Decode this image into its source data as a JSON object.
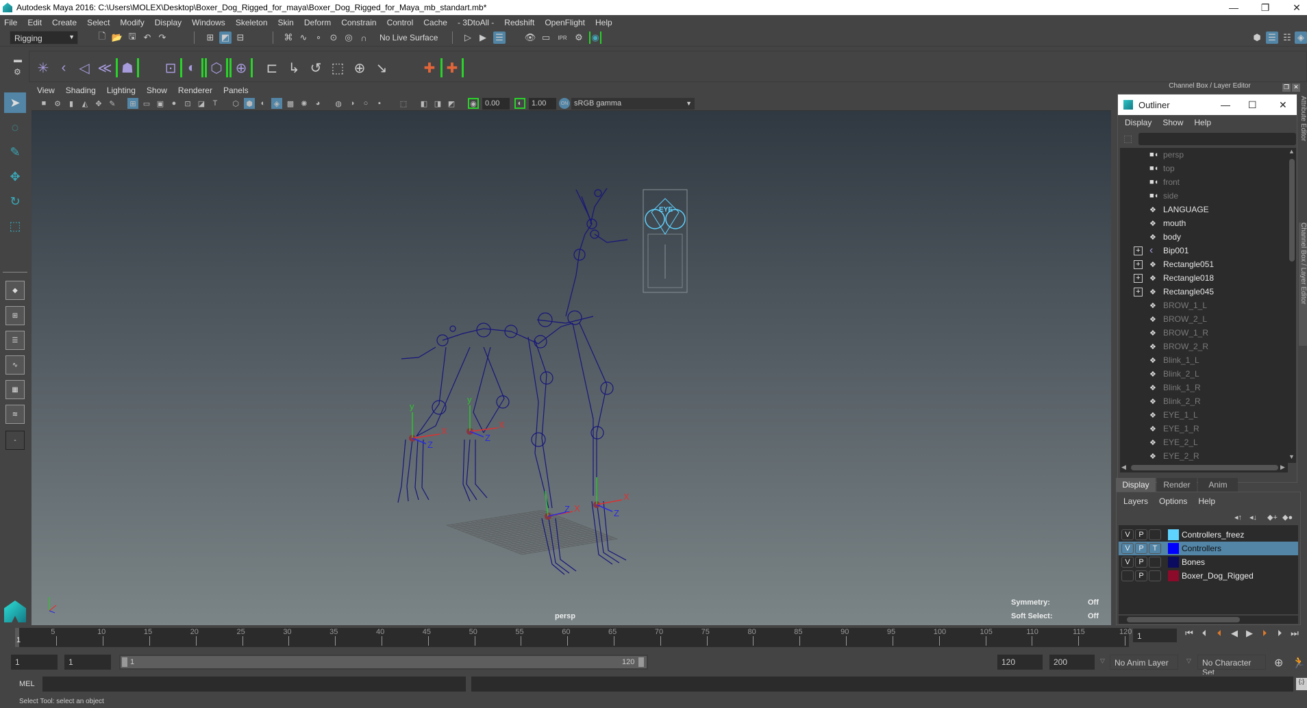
{
  "window": {
    "title": "Autodesk Maya 2016: C:\\Users\\MOLEX\\Desktop\\Boxer_Dog_Rigged_for_maya\\Boxer_Dog_Rigged_for_Maya_mb_standart.mb*",
    "minimize": "—",
    "maximize": "❐",
    "close": "✕"
  },
  "menubar": [
    "File",
    "Edit",
    "Create",
    "Select",
    "Modify",
    "Display",
    "Windows",
    "Skeleton",
    "Skin",
    "Deform",
    "Constrain",
    "Control",
    "Cache",
    "- 3DtoAll -",
    "Redshift",
    "OpenFlight",
    "Help"
  ],
  "status_toolbar": {
    "mode": "Rigging",
    "live_surface": "No Live Surface",
    "icons": [
      "new-scene-icon",
      "open-scene-icon",
      "save-scene-icon",
      "undo-icon",
      "redo-icon",
      "select-hierarchy-icon",
      "select-object-icon",
      "select-component-icon",
      "snap-grid-icon",
      "snap-curve-icon",
      "snap-point-icon",
      "snap-view-icon",
      "snap-surface-icon",
      "snap-live-icon",
      "input-ops-icon",
      "output-ops-icon",
      "history-icon",
      "render-view-icon",
      "render-frame-icon",
      "ipr-render-icon",
      "render-settings-icon",
      "hypershade-icon"
    ]
  },
  "rigging_shelf": {
    "icons": [
      "create-joint-icon",
      "insert-joint-icon",
      "ik-handle-icon",
      "ik-spline-icon",
      "humanik-icon",
      "paint-weights-icon",
      "bind-skin-icon",
      "lattice-icon",
      "cluster-icon",
      "parent-constraint-icon",
      "point-constraint-icon",
      "orient-constraint-icon",
      "scale-constraint-icon",
      "aim-constraint-icon",
      "pole-vector-icon",
      "locator-icon",
      "locator-bracket-icon"
    ]
  },
  "toolbox": {
    "tools": [
      "select-tool-icon",
      "lasso-tool-icon",
      "paint-select-icon",
      "move-tool-icon",
      "rotate-tool-icon",
      "scale-tool-icon"
    ],
    "layouts": [
      "single-view-icon",
      "four-view-icon",
      "outliner-persp-icon",
      "graph-persp-icon",
      "hypershade-persp-icon",
      "timeeditor-persp-icon"
    ],
    "more": "-"
  },
  "viewport": {
    "menu": [
      "View",
      "Shading",
      "Lighting",
      "Show",
      "Renderer",
      "Panels"
    ],
    "near_value": "0.00",
    "far_value": "1.00",
    "color_space": "sRGB gamma",
    "camera_label": "persp",
    "hud": {
      "symmetry_label": "Symmetry:",
      "symmetry_value": "Off",
      "soft_select_label": "Soft Select:",
      "soft_select_value": "Off"
    },
    "eye_controller_label": "EYE"
  },
  "right_panel": {
    "header": "Channel Box / Layer Editor",
    "side_tabs": [
      "Attribute Editor",
      "Channel Box / Layer Editor"
    ]
  },
  "outliner": {
    "title": "Outliner",
    "menu": [
      "Display",
      "Show",
      "Help"
    ],
    "search_value": "",
    "items": [
      {
        "label": "persp",
        "icon": "camera-icon",
        "dim": true,
        "expand": false
      },
      {
        "label": "top",
        "icon": "camera-icon",
        "dim": true,
        "expand": false
      },
      {
        "label": "front",
        "icon": "camera-icon",
        "dim": true,
        "expand": false
      },
      {
        "label": "side",
        "icon": "camera-icon",
        "dim": true,
        "expand": false
      },
      {
        "label": "LANGUAGE",
        "icon": "mesh-icon",
        "dim": false,
        "expand": false
      },
      {
        "label": "mouth",
        "icon": "mesh-icon",
        "dim": false,
        "expand": false
      },
      {
        "label": "body",
        "icon": "mesh-icon",
        "dim": false,
        "expand": false
      },
      {
        "label": "Bip001",
        "icon": "joint-icon",
        "dim": false,
        "expand": true
      },
      {
        "label": "Rectangle051",
        "icon": "mesh-icon",
        "dim": false,
        "expand": true
      },
      {
        "label": "Rectangle018",
        "icon": "mesh-icon",
        "dim": false,
        "expand": true
      },
      {
        "label": "Rectangle045",
        "icon": "mesh-icon",
        "dim": false,
        "expand": true
      },
      {
        "label": "BROW_1_L",
        "icon": "mesh-icon",
        "dim": true,
        "expand": false
      },
      {
        "label": "BROW_2_L",
        "icon": "mesh-icon",
        "dim": true,
        "expand": false
      },
      {
        "label": "BROW_1_R",
        "icon": "mesh-icon",
        "dim": true,
        "expand": false
      },
      {
        "label": "BROW_2_R",
        "icon": "mesh-icon",
        "dim": true,
        "expand": false
      },
      {
        "label": "Blink_1_L",
        "icon": "mesh-icon",
        "dim": true,
        "expand": false
      },
      {
        "label": "Blink_2_L",
        "icon": "mesh-icon",
        "dim": true,
        "expand": false
      },
      {
        "label": "Blink_1_R",
        "icon": "mesh-icon",
        "dim": true,
        "expand": false
      },
      {
        "label": "Blink_2_R",
        "icon": "mesh-icon",
        "dim": true,
        "expand": false
      },
      {
        "label": "EYE_1_L",
        "icon": "mesh-icon",
        "dim": true,
        "expand": false
      },
      {
        "label": "EYE_1_R",
        "icon": "mesh-icon",
        "dim": true,
        "expand": false
      },
      {
        "label": "EYE_2_L",
        "icon": "mesh-icon",
        "dim": true,
        "expand": false
      },
      {
        "label": "EYE_2_R",
        "icon": "mesh-icon",
        "dim": true,
        "expand": false
      }
    ]
  },
  "layer_editor": {
    "tabs": [
      "Display",
      "Render",
      "Anim"
    ],
    "active_tab": "Display",
    "menu": [
      "Layers",
      "Options",
      "Help"
    ],
    "layers": [
      {
        "v": "V",
        "p": "P",
        "t": "",
        "color": "#5fd3ff",
        "name": "Controllers_freez",
        "selected": false
      },
      {
        "v": "V",
        "p": "P",
        "t": "T",
        "color": "#0000ff",
        "name": "Controllers",
        "selected": true
      },
      {
        "v": "V",
        "p": "P",
        "t": "",
        "color": "#0b0b60",
        "name": "Bones",
        "selected": false
      },
      {
        "v": "",
        "p": "P",
        "t": "",
        "color": "#8c0a2a",
        "name": "Boxer_Dog_Rigged",
        "selected": false
      }
    ]
  },
  "timeline": {
    "start": 1,
    "end": 120,
    "ticks": [
      5,
      10,
      15,
      20,
      25,
      30,
      35,
      40,
      45,
      50,
      55,
      60,
      65,
      70,
      75,
      80,
      85,
      90,
      95,
      100,
      105,
      110,
      115,
      120
    ],
    "current_frame": "1",
    "current_frame_field": "1"
  },
  "range": {
    "start_time": "1",
    "playback_start": "1",
    "slider_start": "1",
    "slider_end": "120",
    "playback_end": "120",
    "end_time": "200",
    "anim_layer": "No Anim Layer",
    "character_set": "No Character Set"
  },
  "playback": [
    "go-to-start-icon",
    "step-back-key-icon",
    "prev-key-icon",
    "play-back-icon",
    "play-forward-icon",
    "next-key-icon",
    "step-forward-key-icon",
    "go-to-end-icon"
  ],
  "command_line": {
    "label": "MEL",
    "value": "",
    "result": ""
  },
  "status_line": "Select Tool: select an object",
  "colors": {
    "accent": "#5285a6",
    "bones": "#16167a",
    "controller": "#5fd3ff",
    "x_axis": "#e03030",
    "y_axis": "#2ec42e",
    "z_axis": "#2a2ae0"
  }
}
